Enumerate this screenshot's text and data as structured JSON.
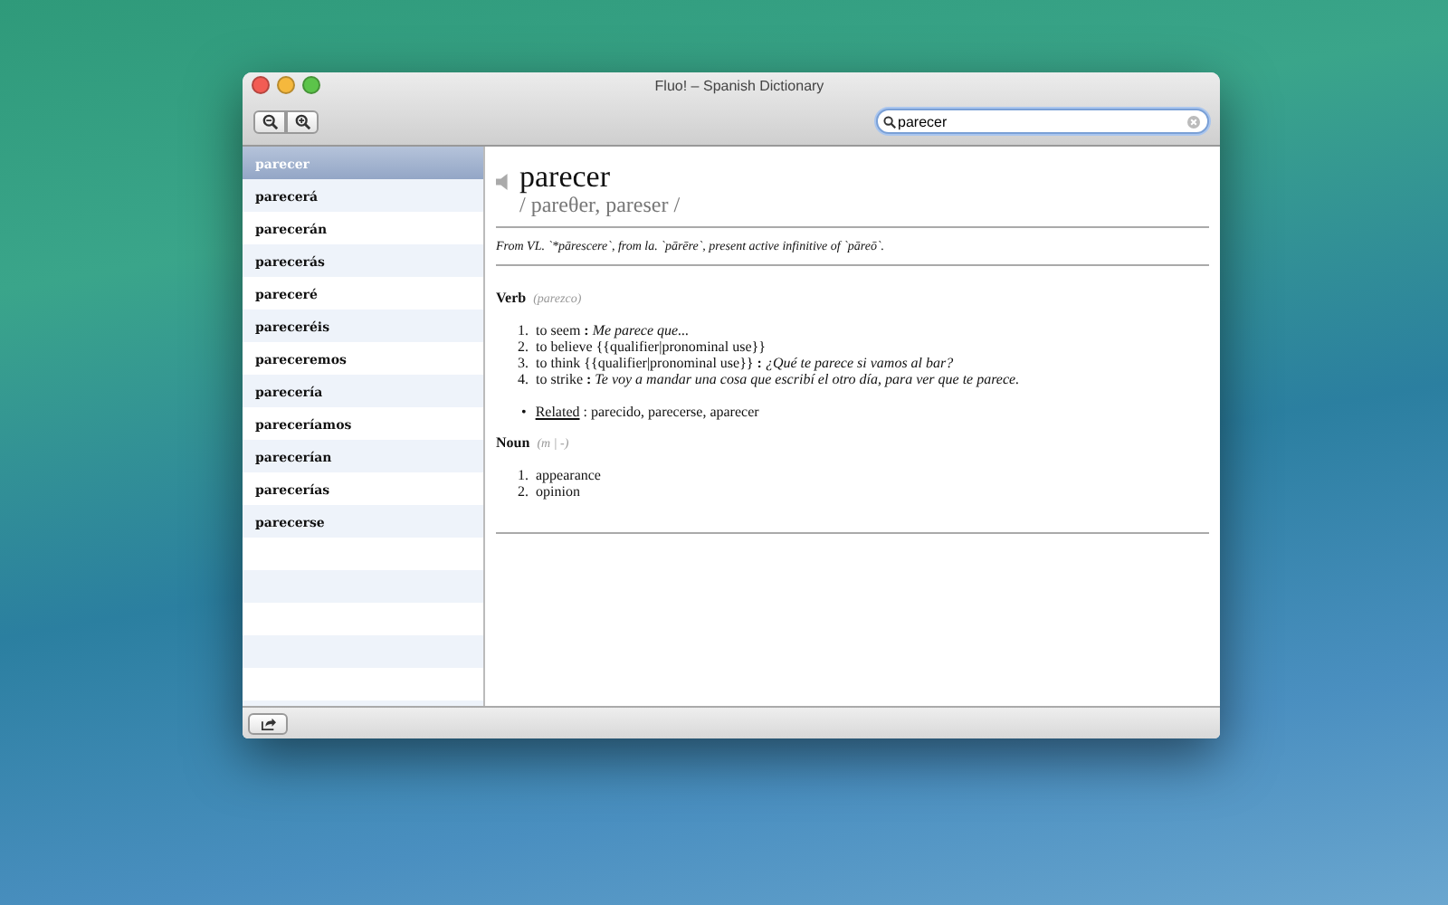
{
  "window": {
    "title": "Fluo! – Spanish Dictionary"
  },
  "search": {
    "value": "parecer"
  },
  "words": [
    {
      "label": "parecer",
      "selected": true
    },
    {
      "label": "parecerá",
      "selected": false
    },
    {
      "label": "parecerán",
      "selected": false
    },
    {
      "label": "parecerás",
      "selected": false
    },
    {
      "label": "pareceré",
      "selected": false
    },
    {
      "label": "pareceréis",
      "selected": false
    },
    {
      "label": "pareceremos",
      "selected": false
    },
    {
      "label": "parecería",
      "selected": false
    },
    {
      "label": "pareceríamos",
      "selected": false
    },
    {
      "label": "parecerían",
      "selected": false
    },
    {
      "label": "parecerías",
      "selected": false
    },
    {
      "label": "parecerse",
      "selected": false
    }
  ],
  "entry": {
    "headword": "parecer",
    "pronunciation": "/ pareθer, pareser /",
    "etymology": "From VL. `*pārescere`, from la. `pārēre`, present active infinitive of `pāreō`.",
    "sections": [
      {
        "pos": "Verb",
        "forms": "(parezco)",
        "senses": [
          {
            "number": "1.",
            "sense": "to seem",
            "separator": ":",
            "example": "Me parece que..."
          },
          {
            "number": "2.",
            "sense": "to believe {{qualifier|pronominal use}}"
          },
          {
            "number": "3.",
            "sense": "to think {{qualifier|pronominal use}}",
            "separator": ":",
            "example": "¿Qué te parece si vamos al bar?"
          },
          {
            "number": "4.",
            "sense": "to strike",
            "separator": ":",
            "example": "Te voy a mandar una cosa que escribí el otro día, para ver que te parece."
          }
        ],
        "related": {
          "bullet": "•",
          "label": "Related",
          "words": ": parecido, parecerse, aparecer"
        }
      },
      {
        "pos": "Noun",
        "forms": "(m | -)",
        "senses": [
          {
            "number": "1.",
            "sense": "appearance"
          },
          {
            "number": "2.",
            "sense": "opinion"
          }
        ]
      }
    ]
  }
}
